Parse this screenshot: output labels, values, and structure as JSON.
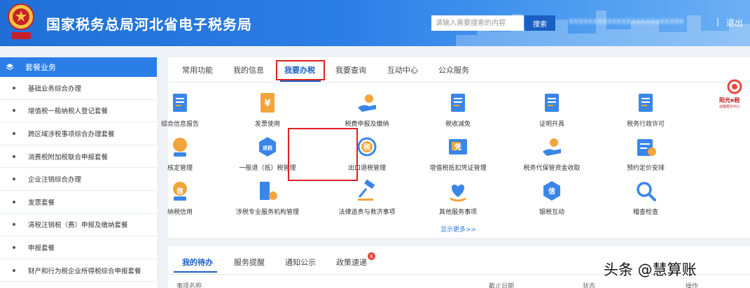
{
  "header": {
    "title": "国家税务总局河北省电子税务局",
    "search_placeholder": "请输入需要搜索的内容",
    "search_button": "搜索",
    "user_name": "XXXXXXXXXXXXXXXXXXXXXXXX",
    "separator": "|",
    "logout": "退出"
  },
  "sidebar": {
    "title": "套餐业务",
    "items": [
      {
        "label": "基础业务综合办理"
      },
      {
        "label": "增值税一般纳税人登记套餐"
      },
      {
        "label": "跨区域涉税事项综合办理套餐"
      },
      {
        "label": "消费税附加税联合申报套餐"
      },
      {
        "label": "企业注销综合办理"
      },
      {
        "label": "发票套餐"
      },
      {
        "label": "清税注销税（费）申报及缴纳套餐"
      },
      {
        "label": "申报套餐"
      },
      {
        "label": "财产和行为税企业所得税综合申报套餐"
      }
    ]
  },
  "main": {
    "tabs": [
      {
        "label": "常用功能"
      },
      {
        "label": "我的信息"
      },
      {
        "label": "我要办税"
      },
      {
        "label": "我要查询"
      },
      {
        "label": "互动中心"
      },
      {
        "label": "公众服务"
      }
    ],
    "active_tab": 2,
    "grid": [
      {
        "label": "综合信息报告",
        "icon": "document-icon"
      },
      {
        "label": "发票使用",
        "icon": "invoice-yen-icon"
      },
      {
        "label": "税费申报及缴纳",
        "icon": "hand-coin-icon"
      },
      {
        "label": "税收减免",
        "icon": "tax-reduction-icon"
      },
      {
        "label": "证明开具",
        "icon": "certificate-icon"
      },
      {
        "label": "税务行政许可",
        "icon": "permit-icon"
      },
      {
        "label": "核定管理",
        "icon": "stamp-icon"
      },
      {
        "label": "一般退（抵）税管理",
        "icon": "refund-icon",
        "icon_text": "退税"
      },
      {
        "label": "出口退税管理",
        "icon": "export-refund-icon",
        "icon_text": "税"
      },
      {
        "label": "增值税抵扣凭证管理",
        "icon": "voucher-icon",
        "icon_text": "凭"
      },
      {
        "label": "税务代保管资金收取",
        "icon": "custody-fund-icon"
      },
      {
        "label": "预约定价安排",
        "icon": "schedule-icon"
      },
      {
        "label": "纳税信用",
        "icon": "credit-icon",
        "icon_text": "信"
      },
      {
        "label": "涉税专业服务机构管理",
        "icon": "building-gear-icon"
      },
      {
        "label": "法律追责与救济事项",
        "icon": "gavel-icon"
      },
      {
        "label": "其他服务事项",
        "icon": "heart-hand-icon"
      },
      {
        "label": "银税互动",
        "icon": "bank-tax-icon",
        "icon_text": "信"
      },
      {
        "label": "稽查检查",
        "icon": "magnifier-icon"
      }
    ],
    "more": "显示更多>>",
    "brand": {
      "name": "阳光e税",
      "sub": "远程帮办中心"
    }
  },
  "todo": {
    "tabs": [
      {
        "label": "我的待办"
      },
      {
        "label": "服务提醒"
      },
      {
        "label": "通知公示"
      },
      {
        "label": "政策速递"
      }
    ],
    "badge": "6",
    "columns": [
      "事项名称",
      "截止日期",
      "状态",
      "操作"
    ]
  },
  "watermark": "头条 @慧算账",
  "colors": {
    "header_blue": "#2b7ee6",
    "active_blue": "#1a5fc4",
    "highlight_red": "#e02020",
    "icon_blue": "#3a86e8",
    "icon_orange": "#f2a53a"
  }
}
